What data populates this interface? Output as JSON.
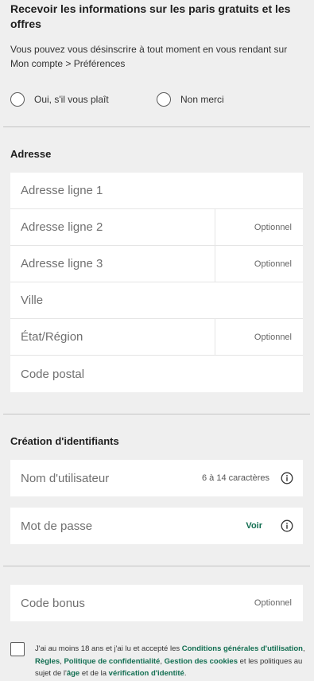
{
  "offers": {
    "title": "Recevoir les informations sur les paris gratuits et les offres",
    "description": "Vous pouvez vous désinscrire à tout moment en vous rendant sur Mon compte > Préférences",
    "options": [
      "Oui, s'il vous plaît",
      "Non merci"
    ]
  },
  "address": {
    "title": "Adresse",
    "fields": [
      {
        "placeholder": "Adresse ligne 1",
        "optional": ""
      },
      {
        "placeholder": "Adresse ligne 2",
        "optional": "Optionnel"
      },
      {
        "placeholder": "Adresse ligne 3",
        "optional": "Optionnel"
      },
      {
        "placeholder": "Ville",
        "optional": ""
      },
      {
        "placeholder": "État/Région",
        "optional": "Optionnel"
      },
      {
        "placeholder": "Code postal",
        "optional": ""
      }
    ]
  },
  "credentials": {
    "title": "Création d'identifiants",
    "username_placeholder": "Nom d'utilisateur",
    "username_hint": "6 à 14 caractères",
    "password_placeholder": "Mot de passe",
    "password_toggle": "Voir"
  },
  "bonus": {
    "placeholder": "Code bonus",
    "optional": "Optionnel"
  },
  "terms": {
    "t1": "J'ai au moins 18 ans et j'ai lu et accepté les ",
    "l1": "Conditions générales d'utilisation",
    "t2": ", ",
    "l2": "Règles",
    "t3": ", ",
    "l3": "Politique de confidentialité",
    "t4": ", ",
    "l4": "Gestion des cookies",
    "t5": " et les politiques au sujet de l'",
    "l5": "âge",
    "t6": " et de la ",
    "l6": "vérification d'identité",
    "t7": "."
  },
  "colors": {
    "accent_green": "#126e51",
    "background": "#efefef"
  }
}
